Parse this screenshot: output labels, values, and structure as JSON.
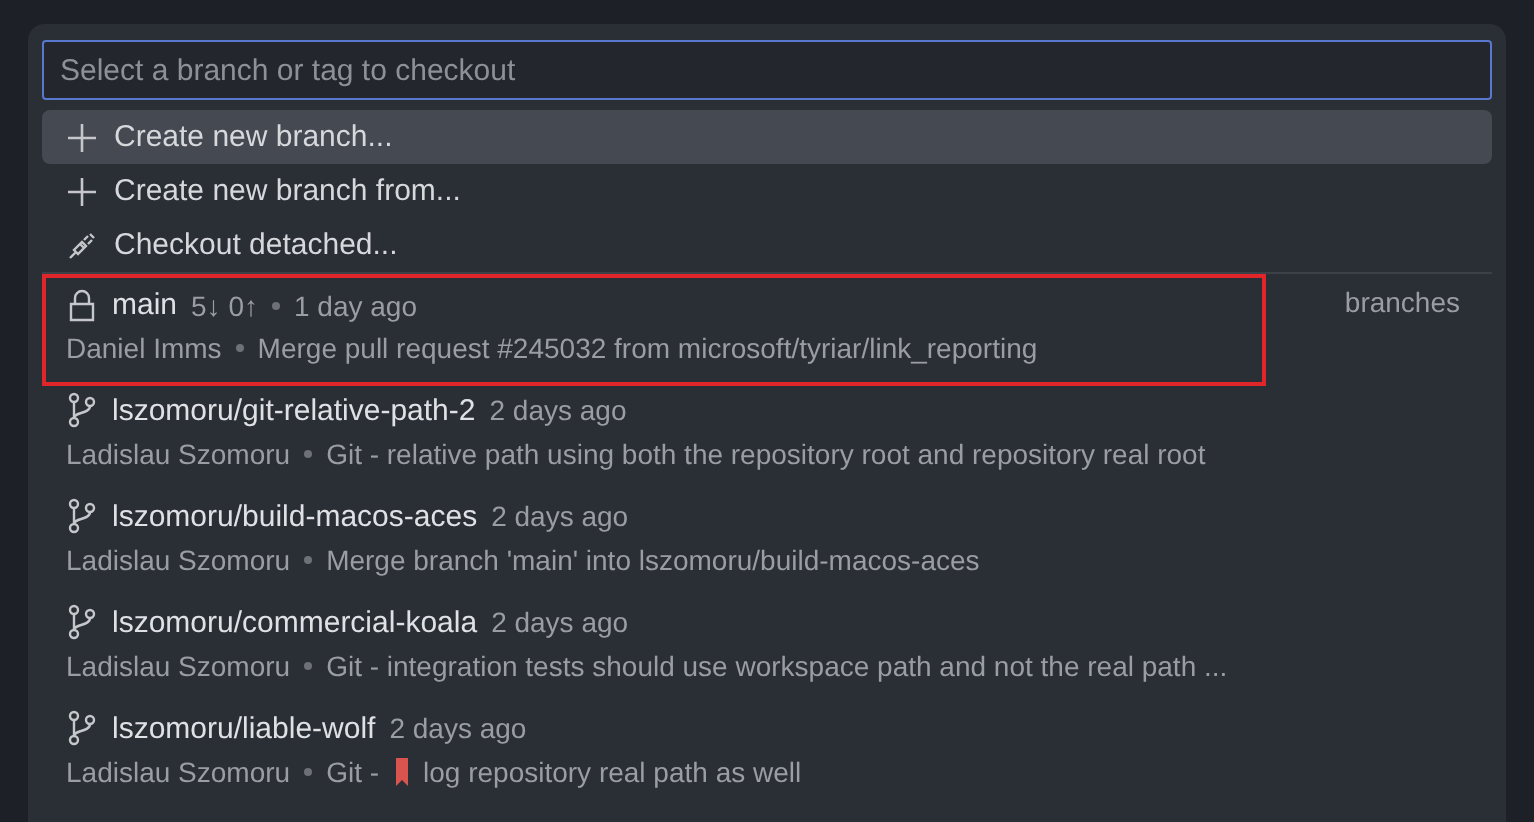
{
  "search": {
    "placeholder": "Select a branch or tag to checkout"
  },
  "actions": [
    {
      "kind": "plus",
      "label": "Create new branch...",
      "selected": true
    },
    {
      "kind": "plus",
      "label": "Create new branch from...",
      "selected": false
    },
    {
      "kind": "detach",
      "label": "Checkout detached...",
      "selected": false
    }
  ],
  "group_label": "branches",
  "branches": [
    {
      "kind": "locked",
      "name": "main",
      "sync": "5↓ 0↑",
      "time": "1 day ago",
      "author": "Daniel Imms",
      "message": "Merge pull request #245032 from microsoft/tyriar/link_reporting",
      "outlined": true
    },
    {
      "kind": "branch",
      "name": "lszomoru/git-relative-path-2",
      "time": "2 days ago",
      "author": "Ladislau Szomoru",
      "message": "Git - relative path using both the repository root and repository real root",
      "outlined": false
    },
    {
      "kind": "branch",
      "name": "lszomoru/build-macos-aces",
      "time": "2 days ago",
      "author": "Ladislau Szomoru",
      "message": "Merge branch 'main' into lszomoru/build-macos-aces",
      "outlined": false
    },
    {
      "kind": "branch",
      "name": "lszomoru/commercial-koala",
      "time": "2 days ago",
      "author": "Ladislau Szomoru",
      "message": "Git - integration tests should use workspace path and not the real path ...",
      "outlined": false
    },
    {
      "kind": "branch",
      "name": "lszomoru/liable-wolf",
      "time": "2 days ago",
      "author": "Ladislau Szomoru",
      "message": "Git -",
      "marker": true,
      "message_rest": "log repository real path as well",
      "outlined": false
    }
  ]
}
